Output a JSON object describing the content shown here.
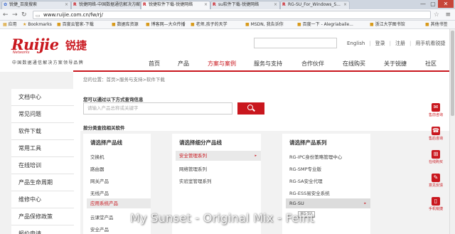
{
  "browser": {
    "tabs": [
      {
        "label": "锐捷_百度搜索",
        "icon": "paw-icon",
        "active": false
      },
      {
        "label": "锐捷网络-中国数据通信解决方案",
        "icon": "ruijie-r-icon",
        "active": false
      },
      {
        "label": "锐捷软件下载-锐捷网络",
        "icon": "ruijie-r-icon",
        "active": true
      },
      {
        "label": "su软件下载-锐捷网络",
        "icon": "ruijie-r-icon",
        "active": false
      },
      {
        "label": "RG-SU_For_Windows_S...",
        "icon": "ruijie-r-icon",
        "active": false
      }
    ],
    "window_buttons": {
      "minimize": "—",
      "maximize": "▢",
      "close": "✕"
    },
    "url": "www.ruijie.com.cn/fw/rj/",
    "bookmarks": [
      "应用",
      "Bookmarks",
      "百度云管家-下载",
      "数据库资源",
      "博客网—大众传播",
      "老师,孩子的天学",
      "MSDN, 我告诉你",
      "百度一下 - Alegriabaile...",
      "浙江大学图书馆",
      "其他书签"
    ]
  },
  "site": {
    "logo_text": "Ruijie",
    "logo_sub": "Networks",
    "logo_cn": "锐捷",
    "slogan": "中国数据通信解决方案领导品牌",
    "top_links": [
      "English",
      "登录",
      "注册",
      "用手机看锐捷"
    ],
    "nav": [
      "首页",
      "产品",
      "方案与案例",
      "服务与支持",
      "合作伙伴",
      "在线购买",
      "关于锐捷",
      "社区"
    ],
    "nav_active_index": 2,
    "accent_color": "#c9171e"
  },
  "sidebar": {
    "items": [
      "文档中心",
      "常见问题",
      "软件下载",
      "常用工具",
      "在线培训",
      "产品生命周期",
      "维修中心",
      "产品保修政策",
      "报价申请"
    ]
  },
  "content": {
    "breadcrumb": "您的位置：首页>服务与支持>软件下载",
    "search_title": "您可以通过以下方式查询信息",
    "search_placeholder": "请输入产品总称或关键字",
    "category_title": "按分类查找相关软件",
    "columns": [
      {
        "heading": "请选择产品线",
        "items": [
          "交换机",
          "路由器",
          "网关产品",
          "无线产品",
          "应用系统产品",
          "云课堂产品",
          "安全产品"
        ],
        "selected_index": 4
      },
      {
        "heading": "请选择细分产品线",
        "items": [
          "安全管理系列",
          "网络管理系列",
          "实验室管理系列"
        ],
        "selected_index": 0
      },
      {
        "heading": "请选择产品系列",
        "items": [
          "RG-IPC身份策略管理中心",
          "RG-SMP专业版",
          "RG-SA安全代理",
          "RG-ESS易安全系统",
          "RG-SU"
        ],
        "selected_index": 4
      }
    ],
    "tooltip": "RG-SU"
  },
  "right_bar": [
    {
      "label": "售前咨询",
      "icon": "chat-icon"
    },
    {
      "label": "售后咨询",
      "icon": "headset-icon"
    },
    {
      "label": "在线购买",
      "icon": "cart-icon"
    },
    {
      "label": "意见反馈",
      "icon": "feedback-icon"
    },
    {
      "label": "手机锐捷",
      "icon": "phone-icon"
    }
  ],
  "overlay_caption": "My Sunset - Original Mix - Feint"
}
